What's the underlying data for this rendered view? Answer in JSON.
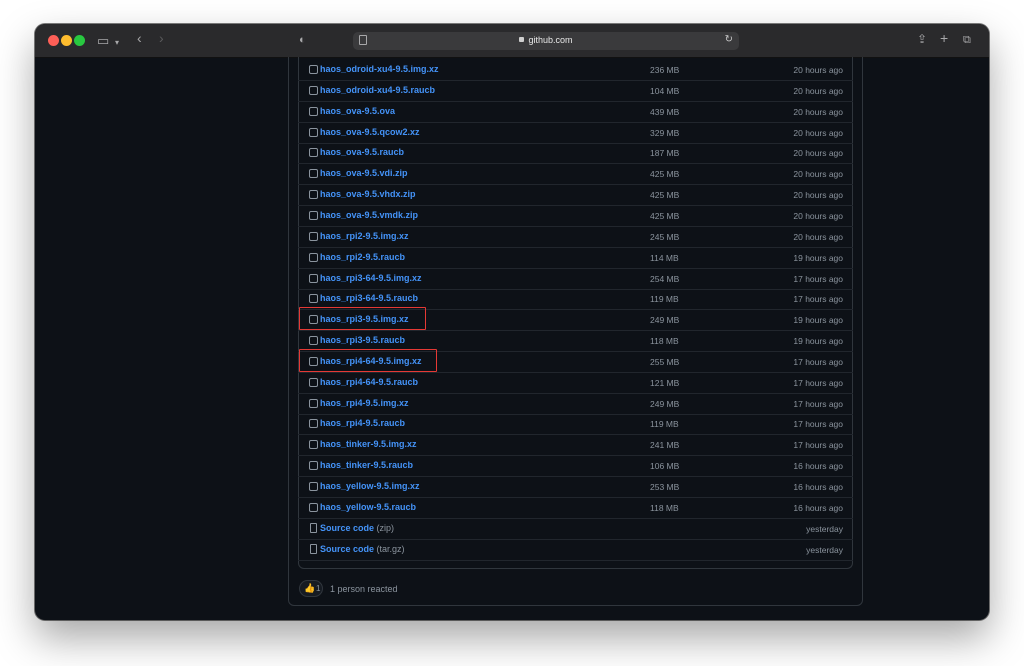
{
  "browser": {
    "url": "github.com",
    "colors": {
      "titlebar": "#2a2a2c",
      "page_bg": "#0d1117",
      "link": "#4493f8",
      "highlight": "#e53935"
    }
  },
  "assets": [
    {
      "name": "haos_odroid-xu4-9.5.img.xz",
      "size": "236 MB",
      "time": "20 hours ago",
      "icon": "package-icon"
    },
    {
      "name": "haos_odroid-xu4-9.5.raucb",
      "size": "104 MB",
      "time": "20 hours ago",
      "icon": "package-icon"
    },
    {
      "name": "haos_ova-9.5.ova",
      "size": "439 MB",
      "time": "20 hours ago",
      "icon": "package-icon"
    },
    {
      "name": "haos_ova-9.5.qcow2.xz",
      "size": "329 MB",
      "time": "20 hours ago",
      "icon": "package-icon"
    },
    {
      "name": "haos_ova-9.5.raucb",
      "size": "187 MB",
      "time": "20 hours ago",
      "icon": "package-icon"
    },
    {
      "name": "haos_ova-9.5.vdi.zip",
      "size": "425 MB",
      "time": "20 hours ago",
      "icon": "package-icon"
    },
    {
      "name": "haos_ova-9.5.vhdx.zip",
      "size": "425 MB",
      "time": "20 hours ago",
      "icon": "package-icon"
    },
    {
      "name": "haos_ova-9.5.vmdk.zip",
      "size": "425 MB",
      "time": "20 hours ago",
      "icon": "package-icon"
    },
    {
      "name": "haos_rpi2-9.5.img.xz",
      "size": "245 MB",
      "time": "20 hours ago",
      "icon": "package-icon"
    },
    {
      "name": "haos_rpi2-9.5.raucb",
      "size": "114 MB",
      "time": "19 hours ago",
      "icon": "package-icon"
    },
    {
      "name": "haos_rpi3-64-9.5.img.xz",
      "size": "254 MB",
      "time": "17 hours ago",
      "icon": "package-icon"
    },
    {
      "name": "haos_rpi3-64-9.5.raucb",
      "size": "119 MB",
      "time": "17 hours ago",
      "icon": "package-icon"
    },
    {
      "name": "haos_rpi3-9.5.img.xz",
      "size": "249 MB",
      "time": "19 hours ago",
      "icon": "package-icon",
      "highlighted": true
    },
    {
      "name": "haos_rpi3-9.5.raucb",
      "size": "118 MB",
      "time": "19 hours ago",
      "icon": "package-icon"
    },
    {
      "name": "haos_rpi4-64-9.5.img.xz",
      "size": "255 MB",
      "time": "17 hours ago",
      "icon": "package-icon",
      "highlighted": true
    },
    {
      "name": "haos_rpi4-64-9.5.raucb",
      "size": "121 MB",
      "time": "17 hours ago",
      "icon": "package-icon"
    },
    {
      "name": "haos_rpi4-9.5.img.xz",
      "size": "249 MB",
      "time": "17 hours ago",
      "icon": "package-icon"
    },
    {
      "name": "haos_rpi4-9.5.raucb",
      "size": "119 MB",
      "time": "17 hours ago",
      "icon": "package-icon"
    },
    {
      "name": "haos_tinker-9.5.img.xz",
      "size": "241 MB",
      "time": "17 hours ago",
      "icon": "package-icon"
    },
    {
      "name": "haos_tinker-9.5.raucb",
      "size": "106 MB",
      "time": "16 hours ago",
      "icon": "package-icon"
    },
    {
      "name": "haos_yellow-9.5.img.xz",
      "size": "253 MB",
      "time": "16 hours ago",
      "icon": "package-icon"
    },
    {
      "name": "haos_yellow-9.5.raucb",
      "size": "118 MB",
      "time": "16 hours ago",
      "icon": "package-icon"
    },
    {
      "name": "Source code",
      "format": "(zip)",
      "size": "",
      "time": "yesterday",
      "icon": "file-zip-icon"
    },
    {
      "name": "Source code",
      "format": "(tar.gz)",
      "size": "",
      "time": "yesterday",
      "icon": "file-zip-icon"
    }
  ],
  "reactions": {
    "emoji": "👍",
    "count": "1",
    "summary": "1 person reacted"
  }
}
